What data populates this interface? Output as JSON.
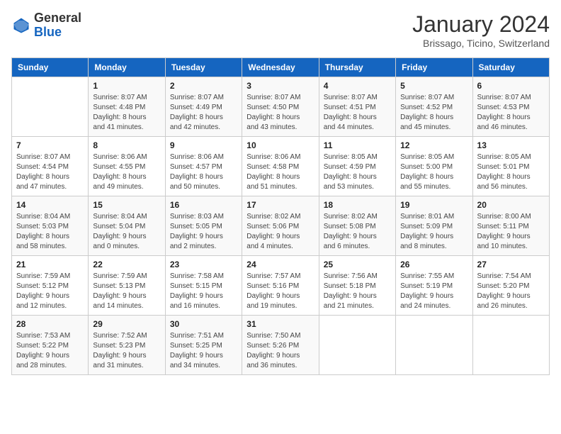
{
  "header": {
    "logo_general": "General",
    "logo_blue": "Blue",
    "month_title": "January 2024",
    "location": "Brissago, Ticino, Switzerland"
  },
  "columns": [
    "Sunday",
    "Monday",
    "Tuesday",
    "Wednesday",
    "Thursday",
    "Friday",
    "Saturday"
  ],
  "weeks": [
    [
      {
        "day": "",
        "info": ""
      },
      {
        "day": "1",
        "info": "Sunrise: 8:07 AM\nSunset: 4:48 PM\nDaylight: 8 hours\nand 41 minutes."
      },
      {
        "day": "2",
        "info": "Sunrise: 8:07 AM\nSunset: 4:49 PM\nDaylight: 8 hours\nand 42 minutes."
      },
      {
        "day": "3",
        "info": "Sunrise: 8:07 AM\nSunset: 4:50 PM\nDaylight: 8 hours\nand 43 minutes."
      },
      {
        "day": "4",
        "info": "Sunrise: 8:07 AM\nSunset: 4:51 PM\nDaylight: 8 hours\nand 44 minutes."
      },
      {
        "day": "5",
        "info": "Sunrise: 8:07 AM\nSunset: 4:52 PM\nDaylight: 8 hours\nand 45 minutes."
      },
      {
        "day": "6",
        "info": "Sunrise: 8:07 AM\nSunset: 4:53 PM\nDaylight: 8 hours\nand 46 minutes."
      }
    ],
    [
      {
        "day": "7",
        "info": "Sunrise: 8:07 AM\nSunset: 4:54 PM\nDaylight: 8 hours\nand 47 minutes."
      },
      {
        "day": "8",
        "info": "Sunrise: 8:06 AM\nSunset: 4:55 PM\nDaylight: 8 hours\nand 49 minutes."
      },
      {
        "day": "9",
        "info": "Sunrise: 8:06 AM\nSunset: 4:57 PM\nDaylight: 8 hours\nand 50 minutes."
      },
      {
        "day": "10",
        "info": "Sunrise: 8:06 AM\nSunset: 4:58 PM\nDaylight: 8 hours\nand 51 minutes."
      },
      {
        "day": "11",
        "info": "Sunrise: 8:05 AM\nSunset: 4:59 PM\nDaylight: 8 hours\nand 53 minutes."
      },
      {
        "day": "12",
        "info": "Sunrise: 8:05 AM\nSunset: 5:00 PM\nDaylight: 8 hours\nand 55 minutes."
      },
      {
        "day": "13",
        "info": "Sunrise: 8:05 AM\nSunset: 5:01 PM\nDaylight: 8 hours\nand 56 minutes."
      }
    ],
    [
      {
        "day": "14",
        "info": "Sunrise: 8:04 AM\nSunset: 5:03 PM\nDaylight: 8 hours\nand 58 minutes."
      },
      {
        "day": "15",
        "info": "Sunrise: 8:04 AM\nSunset: 5:04 PM\nDaylight: 9 hours\nand 0 minutes."
      },
      {
        "day": "16",
        "info": "Sunrise: 8:03 AM\nSunset: 5:05 PM\nDaylight: 9 hours\nand 2 minutes."
      },
      {
        "day": "17",
        "info": "Sunrise: 8:02 AM\nSunset: 5:06 PM\nDaylight: 9 hours\nand 4 minutes."
      },
      {
        "day": "18",
        "info": "Sunrise: 8:02 AM\nSunset: 5:08 PM\nDaylight: 9 hours\nand 6 minutes."
      },
      {
        "day": "19",
        "info": "Sunrise: 8:01 AM\nSunset: 5:09 PM\nDaylight: 9 hours\nand 8 minutes."
      },
      {
        "day": "20",
        "info": "Sunrise: 8:00 AM\nSunset: 5:11 PM\nDaylight: 9 hours\nand 10 minutes."
      }
    ],
    [
      {
        "day": "21",
        "info": "Sunrise: 7:59 AM\nSunset: 5:12 PM\nDaylight: 9 hours\nand 12 minutes."
      },
      {
        "day": "22",
        "info": "Sunrise: 7:59 AM\nSunset: 5:13 PM\nDaylight: 9 hours\nand 14 minutes."
      },
      {
        "day": "23",
        "info": "Sunrise: 7:58 AM\nSunset: 5:15 PM\nDaylight: 9 hours\nand 16 minutes."
      },
      {
        "day": "24",
        "info": "Sunrise: 7:57 AM\nSunset: 5:16 PM\nDaylight: 9 hours\nand 19 minutes."
      },
      {
        "day": "25",
        "info": "Sunrise: 7:56 AM\nSunset: 5:18 PM\nDaylight: 9 hours\nand 21 minutes."
      },
      {
        "day": "26",
        "info": "Sunrise: 7:55 AM\nSunset: 5:19 PM\nDaylight: 9 hours\nand 24 minutes."
      },
      {
        "day": "27",
        "info": "Sunrise: 7:54 AM\nSunset: 5:20 PM\nDaylight: 9 hours\nand 26 minutes."
      }
    ],
    [
      {
        "day": "28",
        "info": "Sunrise: 7:53 AM\nSunset: 5:22 PM\nDaylight: 9 hours\nand 28 minutes."
      },
      {
        "day": "29",
        "info": "Sunrise: 7:52 AM\nSunset: 5:23 PM\nDaylight: 9 hours\nand 31 minutes."
      },
      {
        "day": "30",
        "info": "Sunrise: 7:51 AM\nSunset: 5:25 PM\nDaylight: 9 hours\nand 34 minutes."
      },
      {
        "day": "31",
        "info": "Sunrise: 7:50 AM\nSunset: 5:26 PM\nDaylight: 9 hours\nand 36 minutes."
      },
      {
        "day": "",
        "info": ""
      },
      {
        "day": "",
        "info": ""
      },
      {
        "day": "",
        "info": ""
      }
    ]
  ]
}
